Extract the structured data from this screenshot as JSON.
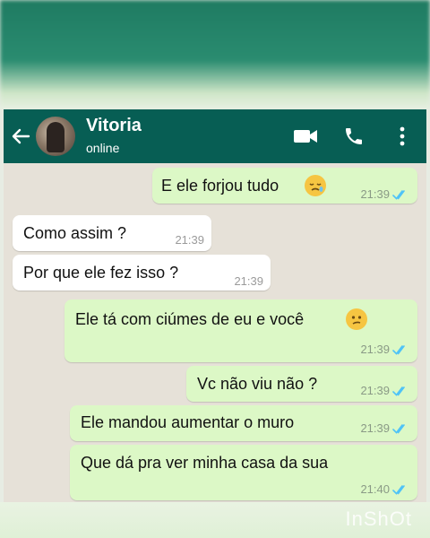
{
  "contact": {
    "name": "Vitoria",
    "status": "online"
  },
  "messages": [
    {
      "dir": "out",
      "text": "E ele forjou tudo",
      "time": "21:39",
      "emoji": "sad-relieved-face"
    },
    {
      "dir": "in",
      "text": "Como assim  ?",
      "time": "21:39"
    },
    {
      "dir": "in",
      "text": "Por que ele fez isso ?",
      "time": "21:39"
    },
    {
      "dir": "out",
      "text": "Ele tá com ciúmes de eu e você",
      "time": "21:39",
      "emoji": "confused-face"
    },
    {
      "dir": "out",
      "text": "Vc não viu não ?",
      "time": "21:39"
    },
    {
      "dir": "out",
      "text": "Ele mandou aumentar o muro",
      "time": "21:39"
    },
    {
      "dir": "out",
      "text": "Que dá pra ver minha casa da sua",
      "time": "21:40"
    }
  ],
  "watermark": "InShOt",
  "colors": {
    "header": "#075e54",
    "outgoing": "#dcf8c6",
    "incoming": "#ffffff",
    "read_ticks": "#4fc3f7"
  }
}
